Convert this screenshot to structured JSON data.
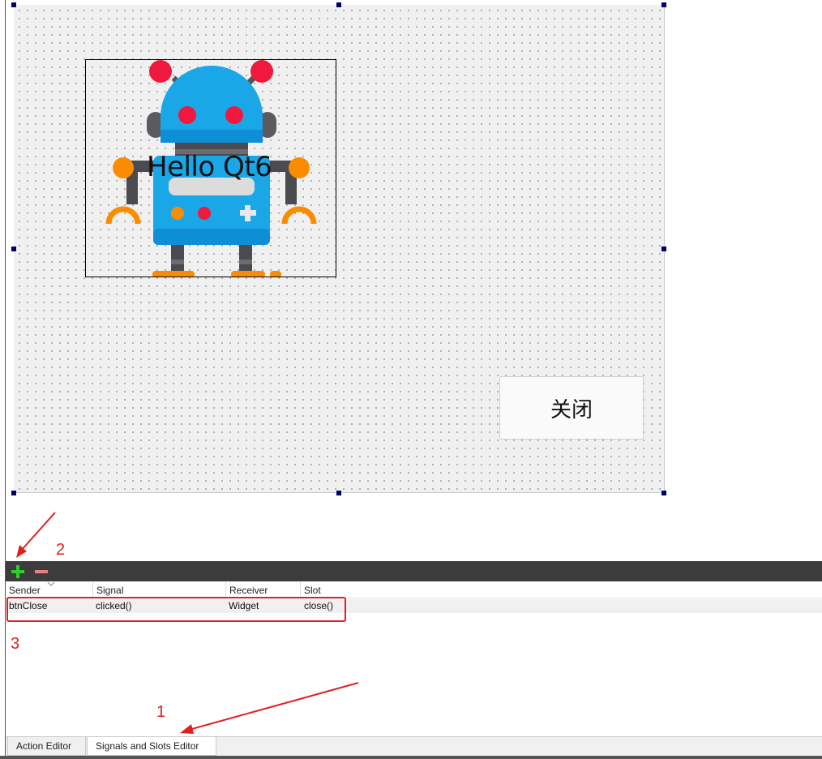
{
  "form": {
    "label_text": "Hello Qt6",
    "close_button_label": "关闭"
  },
  "editor": {
    "columns": [
      "Sender",
      "Signal",
      "Receiver",
      "Slot"
    ],
    "rows": [
      {
        "sender": "btnClose",
        "signal": "clicked()",
        "receiver": "Widget",
        "slot": "close()"
      }
    ],
    "toolbar": {
      "add_icon": "plus-icon",
      "remove_icon": "minus-icon"
    }
  },
  "tabs": [
    {
      "label": "Action Editor",
      "active": false
    },
    {
      "label": "Signals and Slots Editor",
      "active": true
    }
  ],
  "annotations": {
    "num1": "1",
    "num2": "2",
    "num3": "3",
    "color": "#e02020"
  }
}
